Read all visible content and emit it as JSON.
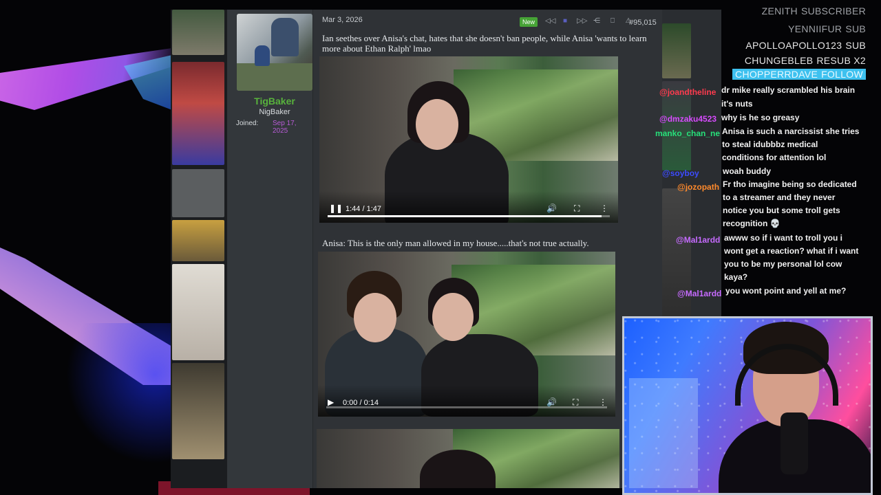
{
  "post": {
    "date": "Mar 3, 2026",
    "new_badge": "New",
    "post_number": "#95,015",
    "user": {
      "name": "TigBaker",
      "title": "NigBaker",
      "joined_label": "Joined:",
      "joined_date": "Sep 17, 2025"
    },
    "caption1": "Ian seethes over Anisa's chat, hates that she doesn't ban people, while Anisa 'wants to learn more about Ethan Ralph' lmao",
    "video1": {
      "time": "1:44 / 1:47",
      "progress": 0.97
    },
    "caption2": "Anisa: This is the only man allowed in my house.....that's not true actually.",
    "video2": {
      "time": "0:00 / 0:14",
      "progress": 0.0
    }
  },
  "alerts": [
    {
      "name": "ZENITH",
      "kind": "SUBSCRIBER",
      "style": "dim"
    },
    {
      "name": "YENNIIFUR",
      "kind": "SUB",
      "style": "dim"
    },
    {
      "name": "APOLLOAPOLLO123",
      "kind": "SUB",
      "style": "normal"
    },
    {
      "name": "CHUNGEBLEB",
      "kind": "RESUB X2",
      "style": "normal"
    },
    {
      "name": "CHOPPERRDAVE",
      "kind": "FOLLOW",
      "style": "highlight"
    }
  ],
  "chat": [
    {
      "user": "@joandtheline",
      "color": "#ff3b4e",
      "lines": [
        "dr mike really scrambled his brain",
        "it's nuts"
      ]
    },
    {
      "user": "@dmzaku4523",
      "color": "#d84bff",
      "lines": [
        "why is he so greasy"
      ]
    },
    {
      "user": "manko_chan_ne",
      "color": "#27e07a",
      "lines": [
        "Anisa is such a narcissist she tries",
        "to steal idubbbz medical",
        "conditions for attention lol"
      ]
    },
    {
      "user": "@soyboy",
      "color": "#3c4cff",
      "lines": [
        "woah buddy"
      ]
    },
    {
      "user": "@jozopath",
      "color": "#ff8a2c",
      "lines": [
        "Fr tho imagine being so dedicated",
        "to a streamer and they never",
        "notice you but some troll gets",
        "recognition 💀"
      ]
    },
    {
      "user": "@Mal1ardd",
      "color": "#c66bff",
      "lines": [
        "awww so if i want to troll you i",
        "wont get a reaction? what if i want",
        "you to be my personal lol cow",
        "kaya?"
      ]
    },
    {
      "user": "@Mal1ardd",
      "color": "#c66bff",
      "lines": [
        "you wont point and yell at me?"
      ]
    }
  ],
  "colors": {
    "username": "#58b23c",
    "joined": "#b85bd6",
    "follow_bg": "#3ec1ef"
  }
}
